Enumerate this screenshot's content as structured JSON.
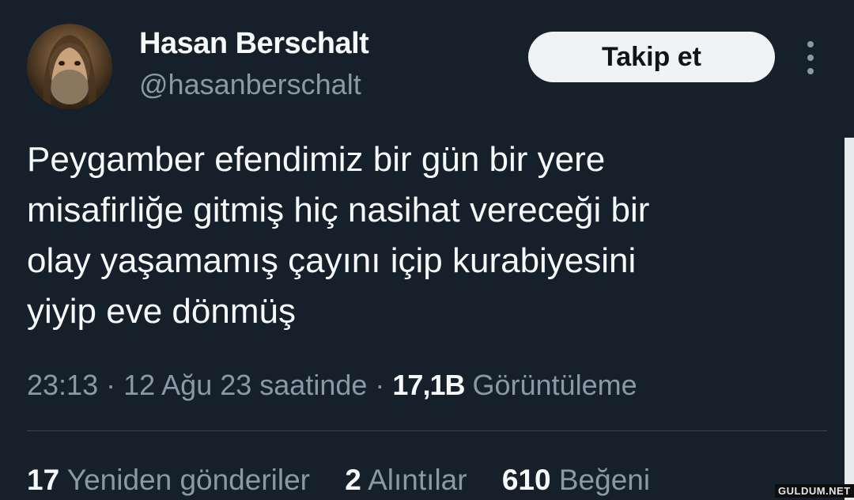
{
  "author": {
    "display_name": "Hasan Berschalt",
    "handle": "@hasanberschalt",
    "follow_label": "Takip et"
  },
  "tweet": {
    "text": "Peygamber efendimiz bir gün bir yere\nmisafirliğe gitmiş hiç nasihat vereceği bir\nolay yaşamamış çayını içip kurabiyesini\nyiyip eve dönmüş",
    "time": "23:13",
    "date": "12 Ağu 23 saatinde",
    "views_count": "17,1B",
    "views_label": "Görüntüleme"
  },
  "stats": {
    "retweets_count": "17",
    "retweets_label": "Yeniden gönderiler",
    "quotes_count": "2",
    "quotes_label": "Alıntılar",
    "likes_count": "610",
    "likes_label": "Beğeni"
  },
  "watermark": "GULDUM.NET",
  "colors": {
    "background": "#15202b",
    "primary_text": "#f7f9f9",
    "secondary_text": "#8b98a5",
    "button_bg": "#eff3f4"
  }
}
